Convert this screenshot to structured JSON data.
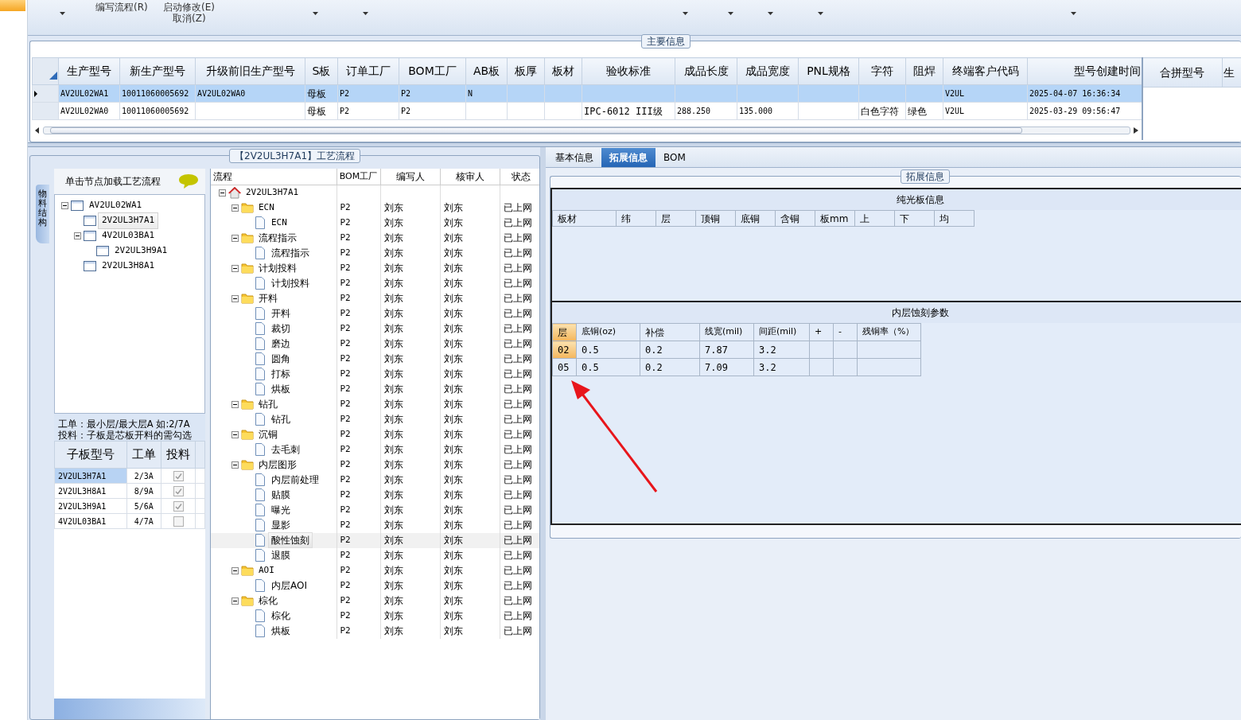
{
  "toolbar": {
    "items": [
      {
        "label": "编写流程(R)"
      },
      {
        "label": "启动修改(E)"
      },
      {
        "label": "取消(Z)"
      }
    ]
  },
  "main_info": {
    "title": "主要信息",
    "columns": [
      "生产型号",
      "新生产型号",
      "升级前旧生产型号",
      "S板",
      "订单工厂",
      "BOM工厂",
      "AB板",
      "板厚",
      "板材",
      "验收标准",
      "成品长度",
      "成品宽度",
      "PNL规格",
      "字符",
      "阻焊",
      "终端客户代码",
      "型号创建时间"
    ],
    "rows": [
      {
        "selected": true,
        "cells": [
          "AV2UL02WA1",
          "10011060005692",
          "AV2UL02WA0",
          "母板",
          "P2",
          "P2",
          "N",
          "",
          "",
          "",
          "",
          "",
          "",
          "",
          "",
          "V2UL",
          "2025-04-07 16:36:34"
        ]
      },
      {
        "selected": false,
        "cells": [
          "AV2UL02WA0",
          "10011060005692",
          "",
          "母板",
          "P2",
          "P2",
          "",
          "",
          "",
          "IPC-6012 III级",
          "288.250",
          "135.000",
          "",
          "白色字符",
          "绿色",
          "V2UL",
          "2025-03-29 09:56:47"
        ]
      }
    ],
    "side_columns": [
      "合拼型号",
      "生"
    ]
  },
  "process_title": "【2V2UL3H7A1】工艺流程",
  "side_tab": "物料结构",
  "hint": "单击节点加载工艺流程",
  "model_tree": [
    {
      "label": "AV2UL02WA1",
      "selected": false,
      "children": [
        {
          "label": "2V2UL3H7A1",
          "selected": true
        },
        {
          "label": "4V2UL03BA1",
          "selected": false,
          "children": [
            {
              "label": "2V2UL3H9A1",
              "selected": false
            }
          ]
        },
        {
          "label": "2V2UL3H8A1",
          "selected": false
        }
      ]
    }
  ],
  "notes": [
    "工单：最小层/最大层A 如:2/7A",
    "投料：子板是芯板开料的需勾选"
  ],
  "sub_boards": {
    "columns": [
      "子板型号",
      "工单",
      "投料"
    ],
    "rows": [
      {
        "model": "2V2UL3H7A1",
        "order": "2/3A",
        "checked": true,
        "selected": true
      },
      {
        "model": "2V2UL3H8A1",
        "order": "8/9A",
        "checked": true,
        "selected": false
      },
      {
        "model": "2V2UL3H9A1",
        "order": "5/6A",
        "checked": true,
        "selected": false
      },
      {
        "model": "4V2UL03BA1",
        "order": "4/7A",
        "checked": false,
        "selected": false
      }
    ]
  },
  "flow": {
    "columns": [
      "流程",
      "BOM工厂",
      "编写人",
      "核审人",
      "状态"
    ],
    "tree": [
      {
        "label": "2V2UL3H7A1",
        "kind": "root",
        "selected": false,
        "children": [
          {
            "label": "ECN",
            "kind": "folder",
            "selected": false,
            "cells": [
              "P2",
              "刘东",
              "刘东",
              "已上网"
            ],
            "children": [
              {
                "label": "ECN",
                "kind": "leaf",
                "selected": false,
                "cells": [
                  "P2",
                  "刘东",
                  "刘东",
                  "已上网"
                ]
              }
            ]
          },
          {
            "label": "流程指示",
            "kind": "folder",
            "selected": false,
            "cells": [
              "P2",
              "刘东",
              "刘东",
              "已上网"
            ],
            "children": [
              {
                "label": "流程指示",
                "kind": "leaf",
                "selected": false,
                "cells": [
                  "P2",
                  "刘东",
                  "刘东",
                  "已上网"
                ]
              }
            ]
          },
          {
            "label": "计划投料",
            "kind": "folder",
            "selected": false,
            "cells": [
              "P2",
              "刘东",
              "刘东",
              "已上网"
            ],
            "children": [
              {
                "label": "计划投料",
                "kind": "leaf",
                "selected": false,
                "cells": [
                  "P2",
                  "刘东",
                  "刘东",
                  "已上网"
                ]
              }
            ]
          },
          {
            "label": "开料",
            "kind": "folder",
            "selected": false,
            "cells": [
              "P2",
              "刘东",
              "刘东",
              "已上网"
            ],
            "children": [
              {
                "label": "开料",
                "kind": "leaf",
                "selected": false,
                "cells": [
                  "P2",
                  "刘东",
                  "刘东",
                  "已上网"
                ]
              },
              {
                "label": "裁切",
                "kind": "leaf",
                "selected": false,
                "cells": [
                  "P2",
                  "刘东",
                  "刘东",
                  "已上网"
                ]
              },
              {
                "label": "磨边",
                "kind": "leaf",
                "selected": false,
                "cells": [
                  "P2",
                  "刘东",
                  "刘东",
                  "已上网"
                ]
              },
              {
                "label": "圆角",
                "kind": "leaf",
                "selected": false,
                "cells": [
                  "P2",
                  "刘东",
                  "刘东",
                  "已上网"
                ]
              },
              {
                "label": "打标",
                "kind": "leaf",
                "selected": false,
                "cells": [
                  "P2",
                  "刘东",
                  "刘东",
                  "已上网"
                ]
              },
              {
                "label": "烘板",
                "kind": "leaf",
                "selected": false,
                "cells": [
                  "P2",
                  "刘东",
                  "刘东",
                  "已上网"
                ]
              }
            ]
          },
          {
            "label": "钻孔",
            "kind": "folder",
            "selected": false,
            "cells": [
              "P2",
              "刘东",
              "刘东",
              "已上网"
            ],
            "children": [
              {
                "label": "钻孔",
                "kind": "leaf",
                "selected": false,
                "cells": [
                  "P2",
                  "刘东",
                  "刘东",
                  "已上网"
                ]
              }
            ]
          },
          {
            "label": "沉铜",
            "kind": "folder",
            "selected": false,
            "cells": [
              "P2",
              "刘东",
              "刘东",
              "已上网"
            ],
            "children": [
              {
                "label": "去毛刺",
                "kind": "leaf",
                "selected": false,
                "cells": [
                  "P2",
                  "刘东",
                  "刘东",
                  "已上网"
                ]
              }
            ]
          },
          {
            "label": "内层图形",
            "kind": "folder",
            "selected": false,
            "cells": [
              "P2",
              "刘东",
              "刘东",
              "已上网"
            ],
            "children": [
              {
                "label": "内层前处理",
                "kind": "leaf",
                "selected": false,
                "cells": [
                  "P2",
                  "刘东",
                  "刘东",
                  "已上网"
                ]
              },
              {
                "label": "贴膜",
                "kind": "leaf",
                "selected": false,
                "cells": [
                  "P2",
                  "刘东",
                  "刘东",
                  "已上网"
                ]
              },
              {
                "label": "曝光",
                "kind": "leaf",
                "selected": false,
                "cells": [
                  "P2",
                  "刘东",
                  "刘东",
                  "已上网"
                ]
              },
              {
                "label": "显影",
                "kind": "leaf",
                "selected": false,
                "cells": [
                  "P2",
                  "刘东",
                  "刘东",
                  "已上网"
                ]
              },
              {
                "label": "酸性蚀刻",
                "kind": "leaf",
                "selected": true,
                "cells": [
                  "P2",
                  "刘东",
                  "刘东",
                  "已上网"
                ]
              },
              {
                "label": "退膜",
                "kind": "leaf",
                "selected": false,
                "cells": [
                  "P2",
                  "刘东",
                  "刘东",
                  "已上网"
                ]
              }
            ]
          },
          {
            "label": "AOI",
            "kind": "folder",
            "selected": false,
            "cells": [
              "P2",
              "刘东",
              "刘东",
              "已上网"
            ],
            "children": [
              {
                "label": "内层AOI",
                "kind": "leaf",
                "selected": false,
                "cells": [
                  "P2",
                  "刘东",
                  "刘东",
                  "已上网"
                ]
              }
            ]
          },
          {
            "label": "棕化",
            "kind": "folder",
            "selected": false,
            "cells": [
              "P2",
              "刘东",
              "刘东",
              "已上网"
            ],
            "children": [
              {
                "label": "棕化",
                "kind": "leaf",
                "selected": false,
                "cells": [
                  "P2",
                  "刘东",
                  "刘东",
                  "已上网"
                ]
              },
              {
                "label": "烘板",
                "kind": "leaf",
                "selected": false,
                "cells": [
                  "P2",
                  "刘东",
                  "刘东",
                  "已上网"
                ]
              }
            ]
          }
        ]
      }
    ]
  },
  "tabs": [
    {
      "label": "基本信息",
      "selected": false
    },
    {
      "label": "拓展信息",
      "selected": true
    },
    {
      "label": "BOM",
      "selected": false
    }
  ],
  "ext_title": "拓展信息",
  "bare_board": {
    "title": "纯光板信息",
    "columns": [
      "板材",
      "纬",
      "层",
      "顶铜",
      "底铜",
      "含铜",
      "板mm",
      "上",
      "下",
      "均"
    ]
  },
  "inner_etch": {
    "title": "内层蚀刻参数",
    "columns": [
      "层",
      "底铜(oz)",
      "补偿",
      "线宽(mil)",
      "间距(mil)",
      "+",
      "-",
      "残铜率（%）"
    ],
    "rows": [
      {
        "selected": true,
        "cells": [
          "02",
          "0.5",
          "0.2",
          "7.87",
          "3.2",
          "",
          "",
          ""
        ]
      },
      {
        "selected": false,
        "cells": [
          "05",
          "0.5",
          "0.2",
          "7.09",
          "3.2",
          "",
          "",
          ""
        ]
      }
    ]
  }
}
